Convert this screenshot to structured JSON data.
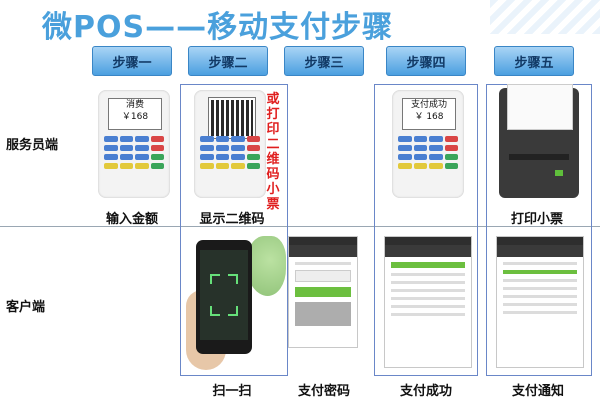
{
  "title": "微POS——移动支付步骤",
  "steps": [
    "步骤一",
    "步骤二",
    "步骤三",
    "步骤四",
    "步骤五"
  ],
  "row_labels": {
    "waiter": "服务员端",
    "customer": "客户端"
  },
  "waiter_captions": [
    "输入金额",
    "显示二维码",
    "打印小票"
  ],
  "customer_captions": [
    "扫一扫",
    "支付密码",
    "支付成功",
    "支付通知"
  ],
  "side_note": "或打印二维码小票",
  "pos_screens": {
    "step1_line1": "消费",
    "step1_line2": "￥168",
    "step4_line1": "支付成功",
    "step4_line2": "￥ 168"
  },
  "colors": {
    "title": "#4aa0dc",
    "step_fill": "#4b9fe0",
    "frame": "#6a87c8",
    "note": "#e01e1e"
  }
}
